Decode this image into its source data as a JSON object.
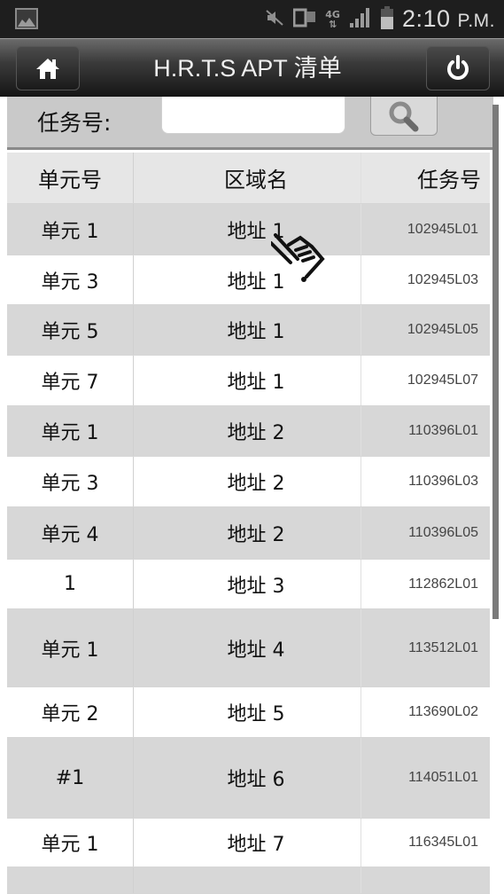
{
  "status_bar": {
    "notification_icon": "gallery-icon",
    "icons": [
      "mute-icon",
      "sd-card-icon",
      "4g-data-icon",
      "signal-icon",
      "battery-icon"
    ],
    "network_label": "4G",
    "time": "2:10",
    "ampm": "P.M."
  },
  "title_bar": {
    "title": "H.R.T.S APT 清单",
    "home_icon": "home-icon",
    "power_icon": "power-icon"
  },
  "search": {
    "label": "任务号:",
    "value": "",
    "placeholder": "",
    "button_icon": "search-icon"
  },
  "table": {
    "columns": [
      "单元号",
      "区域名",
      "任务号"
    ],
    "rows": [
      {
        "unit": "单元 1",
        "area": "地址 1",
        "task": "102945L01"
      },
      {
        "unit": "单元 3",
        "area": "地址 1",
        "task": "102945L03"
      },
      {
        "unit": "单元 5",
        "area": "地址 1",
        "task": "102945L05"
      },
      {
        "unit": "单元 7",
        "area": "地址 1",
        "task": "102945L07"
      },
      {
        "unit": "单元 1",
        "area": "地址 2",
        "task": "110396L01"
      },
      {
        "unit": "单元 3",
        "area": "地址 2",
        "task": "110396L03"
      },
      {
        "unit": "单元 4",
        "area": "地址 2",
        "task": "110396L05"
      },
      {
        "unit": "1",
        "area": "地址 3",
        "task": "112862L01"
      },
      {
        "unit": "单元 1",
        "area": "地址 4",
        "task": "113512L01"
      },
      {
        "unit": "单元 2",
        "area": "地址 5",
        "task": "113690L02"
      },
      {
        "unit": "#1",
        "area": "地址 6",
        "task": "114051L01"
      },
      {
        "unit": "单元 1",
        "area": "地址 7",
        "task": "116345L01"
      },
      {
        "unit": "",
        "area": "",
        "task": ""
      }
    ]
  },
  "colors": {
    "status_bar_bg": "#1e1e1e",
    "title_bar_bg": "#2a2a2a",
    "row_shaded": "#d7d7d7",
    "row_white": "#ffffff"
  }
}
